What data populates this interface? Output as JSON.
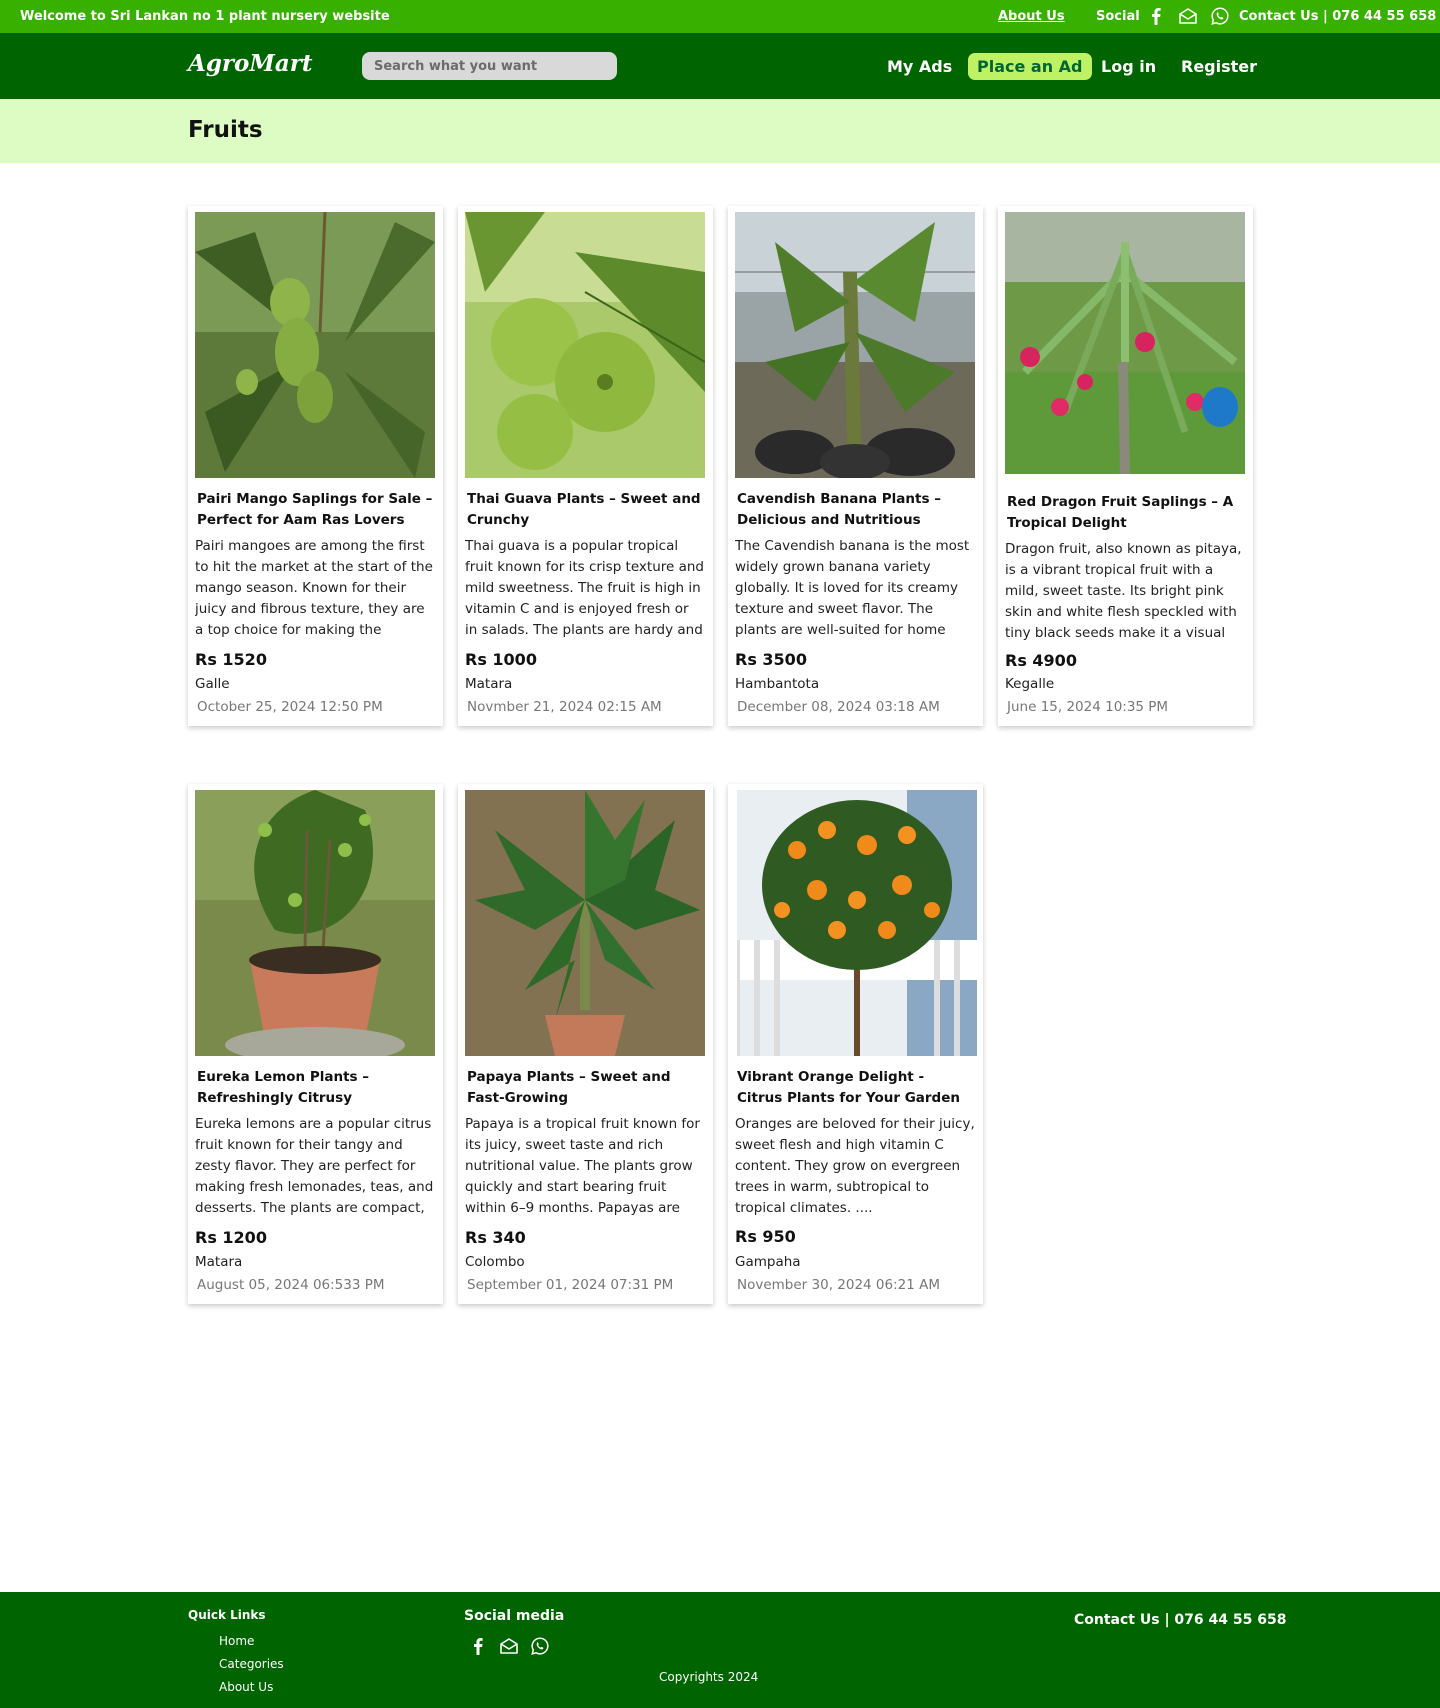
{
  "topbar": {
    "welcome": "Welcome to Sri Lankan no 1 plant nursery website",
    "about_us": "About Us",
    "social_label": "Social",
    "contact": "Contact Us | 076 44 55 658",
    "icons": [
      "facebook-icon",
      "mail-icon",
      "whatsapp-icon"
    ]
  },
  "navbar": {
    "logo": "AgroMart",
    "search_placeholder": "Search what you want",
    "my_ads": "My Ads",
    "place_ad": "Place an Ad",
    "login": "Log in",
    "register": "Register"
  },
  "category": {
    "title": "Fruits"
  },
  "listings": [
    {
      "title": "Pairi Mango Saplings for Sale – Perfect for Aam Ras Lovers",
      "description": "Pairi mangoes are among the first to hit the market at the start of the mango season. Known for their juicy and fibrous texture, they are a top choice for making the famous ...",
      "price": "Rs 1520",
      "location": "Galle",
      "date": "October 25, 2024 12:50 PM",
      "image": "mango-plant"
    },
    {
      "title": "Thai Guava Plants – Sweet and Crunchy",
      "description": "Thai guava is a popular tropical fruit known for its crisp texture and mild sweetness. The fruit is high in vitamin C and is enjoyed fresh or in salads. The plants are hardy and can thrive...",
      "price": "Rs 1000",
      "location": "Matara",
      "date": "Novmber 21, 2024 02:15 AM",
      "image": "guava-plant"
    },
    {
      "title": "Cavendish Banana Plants – Delicious and Nutritious",
      "description": "The Cavendish banana is the most widely grown banana variety globally. It is loved for its creamy texture and sweet flavor. The plants are well-suited for home gardens,...",
      "price": "Rs 3500",
      "location": "Hambantota",
      "date": "December 08, 2024 03:18 AM",
      "image": "banana-plant"
    },
    {
      "title": "Red Dragon Fruit Saplings – A Tropical Delight",
      "description": "Dragon fruit, also known as pitaya, is a vibrant tropical fruit with a mild, sweet taste. Its bright pink skin and white flesh speckled with tiny black seeds make it a visual treat. The ...",
      "price": "Rs 4900",
      "location": "Kegalle",
      "date": "June 15, 2024 10:35 PM",
      "image": "dragon-fruit-plant"
    },
    {
      "title": "Eureka Lemon Plants – Refreshingly Citrusy",
      "description": "Eureka lemons are a popular citrus fruit known for their tangy and zesty flavor. They are perfect for making fresh lemonades, teas, and desserts. The plants are compact, making ...",
      "price": "Rs 1200",
      "location": "Matara",
      "date": "August 05, 2024 06:533 PM",
      "image": "lemon-plant"
    },
    {
      "title": "Papaya Plants – Sweet and Fast-Growing",
      "description": "Papaya is a tropical fruit known for its juicy, sweet taste and rich nutritional value. The plants grow quickly and start bearing fruit within 6–9 months. Papayas are rich in vitamins A and C..",
      "price": "Rs 340",
      "location": "Colombo",
      "date": "September 01, 2024 07:31 PM",
      "image": "papaya-plant"
    },
    {
      "title": "Vibrant Orange Delight - Citrus Plants for Your Garden",
      "description": "Oranges are beloved for their juicy, sweet flesh and high vitamin C content. They grow on evergreen trees in warm, subtropical to tropical climates. ....",
      "price": "Rs 950",
      "location": "Gampaha",
      "date": "November 30, 2024 06:21 AM",
      "image": "orange-plant"
    }
  ],
  "footer": {
    "quick_links_title": "Quick Links",
    "quick_links": [
      "Home",
      "Categories",
      "About Us"
    ],
    "social_title": "Social  media",
    "copyright": "Copyrights 2024",
    "contact": "Contact Us | 076 44 55 658"
  },
  "colors": {
    "topbar": "#38b000",
    "navbar": "#006400",
    "accent": "#bef264",
    "band": "#dcfcc4"
  }
}
